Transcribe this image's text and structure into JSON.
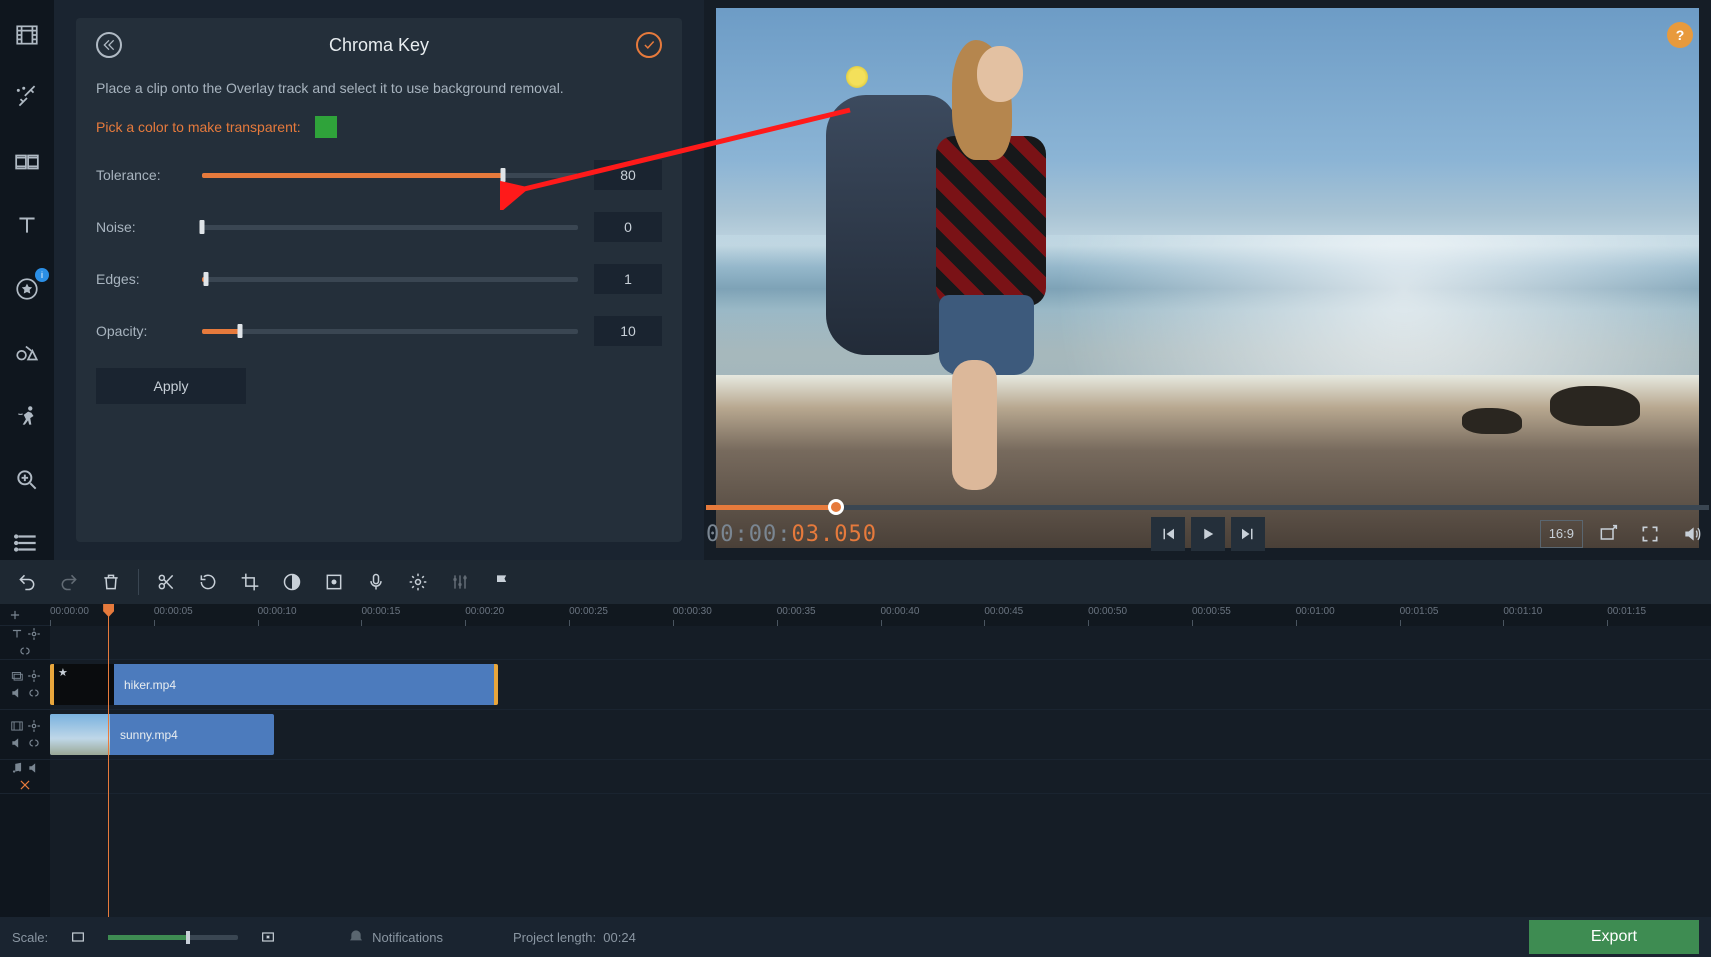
{
  "sidebar": {
    "tools": [
      {
        "name": "media-library",
        "icon": "film"
      },
      {
        "name": "filters",
        "icon": "wand"
      },
      {
        "name": "transitions",
        "icon": "transition"
      },
      {
        "name": "titles",
        "icon": "text"
      },
      {
        "name": "stickers",
        "icon": "star",
        "badge": "i"
      },
      {
        "name": "callouts",
        "icon": "shapes"
      },
      {
        "name": "animation",
        "icon": "runner"
      },
      {
        "name": "zoom-pan",
        "icon": "magnifier"
      },
      {
        "name": "more-tools",
        "icon": "list"
      }
    ]
  },
  "panel": {
    "title": "Chroma Key",
    "hint": "Place a clip onto the Overlay track and select it to use background removal.",
    "color_label": "Pick a color to make transparent:",
    "color_value": "#2fa33a",
    "sliders": [
      {
        "label": "Tolerance:",
        "value": "80",
        "pct": 80
      },
      {
        "label": "Noise:",
        "value": "0",
        "pct": 0
      },
      {
        "label": "Edges:",
        "value": "1",
        "pct": 1
      },
      {
        "label": "Opacity:",
        "value": "10",
        "pct": 10
      }
    ],
    "apply_label": "Apply"
  },
  "preview": {
    "timecode_gray": "00:00:",
    "timecode_orange": "03.050",
    "ratio_label": "16:9",
    "scrub_pct": 13
  },
  "toolbar": {
    "buttons": [
      {
        "name": "undo",
        "icon": "undo",
        "enabled": true
      },
      {
        "name": "redo",
        "icon": "redo",
        "enabled": false
      },
      {
        "name": "delete",
        "icon": "trash",
        "enabled": true
      },
      {
        "sep": true
      },
      {
        "name": "split",
        "icon": "scissors",
        "enabled": true
      },
      {
        "name": "rotate",
        "icon": "rotate",
        "enabled": true
      },
      {
        "name": "crop",
        "icon": "crop",
        "enabled": true
      },
      {
        "name": "color-adjust",
        "icon": "contrast",
        "enabled": true
      },
      {
        "name": "record",
        "icon": "record",
        "enabled": true
      },
      {
        "name": "voiceover",
        "icon": "mic",
        "enabled": true
      },
      {
        "name": "clip-properties",
        "icon": "gear",
        "enabled": true
      },
      {
        "name": "equalizer",
        "icon": "sliders",
        "enabled": false
      },
      {
        "name": "marker",
        "icon": "flag",
        "enabled": true
      }
    ]
  },
  "timeline": {
    "ticks": [
      "00:00:00",
      "00:00:05",
      "00:00:10",
      "00:00:15",
      "00:00:20",
      "00:00:25",
      "00:00:30",
      "00:00:35",
      "00:00:40",
      "00:00:45",
      "00:00:50",
      "00:00:55",
      "00:01:00",
      "00:01:05",
      "00:01:10",
      "00:01:15"
    ],
    "playhead_pct": 3.5,
    "clips": [
      {
        "track": 1,
        "name": "hiker.mp4",
        "start_pct": 0,
        "width_pct": 27,
        "selected": true,
        "star": true,
        "thumb": "dark"
      },
      {
        "track": 2,
        "name": "sunny.mp4",
        "start_pct": 0,
        "width_pct": 13.5,
        "selected": false,
        "thumb": "sky"
      }
    ]
  },
  "status": {
    "scale_label": "Scale:",
    "scale_pct": 60,
    "notifications_label": "Notifications",
    "project_length_label": "Project length:",
    "project_length_value": "00:24",
    "export_label": "Export"
  }
}
